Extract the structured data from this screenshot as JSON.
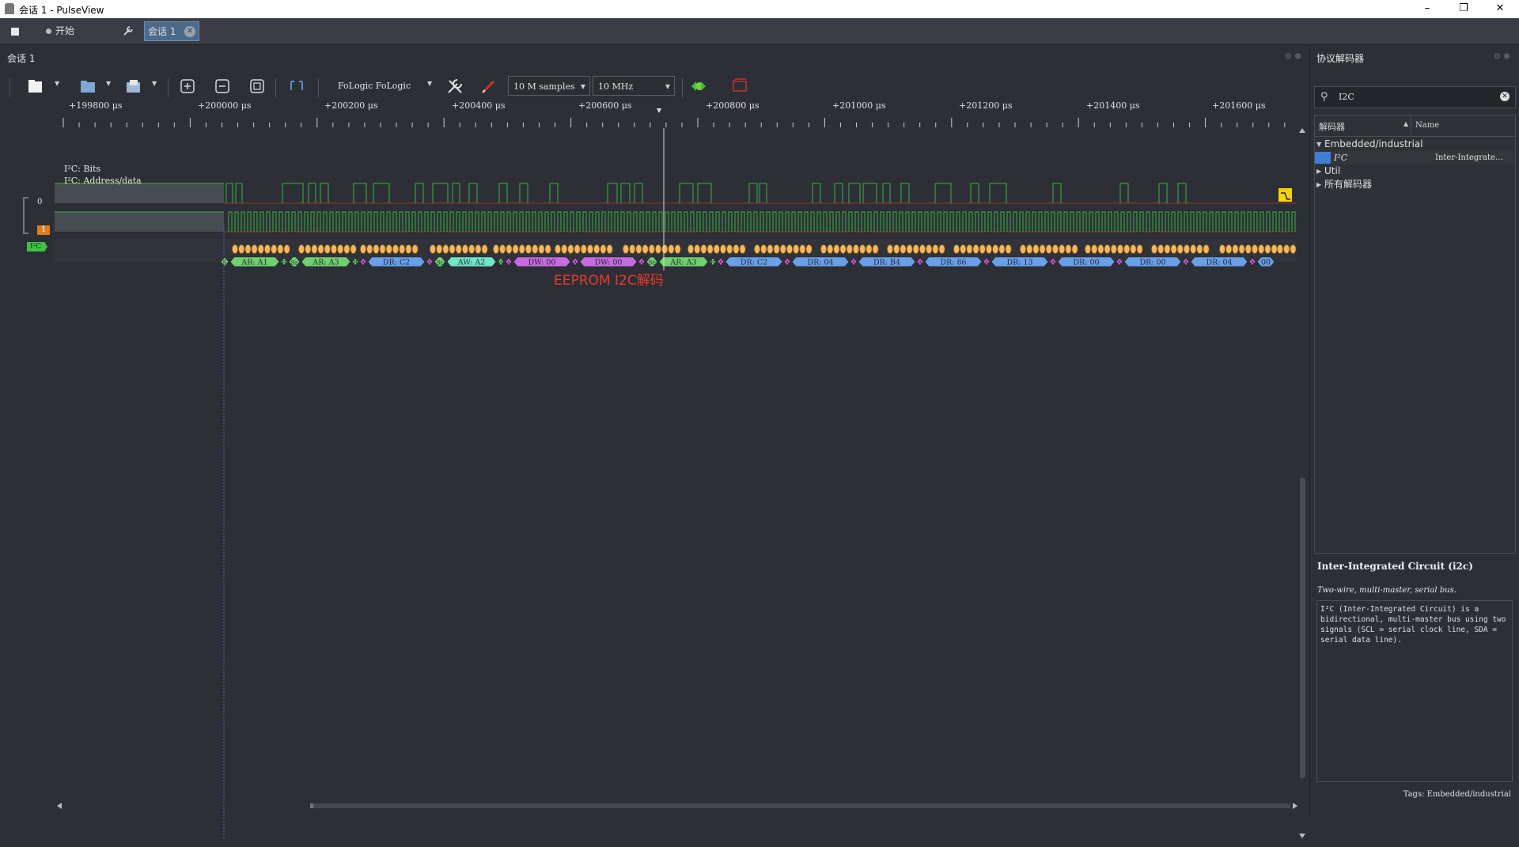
{
  "window": {
    "title": "会话 1 - PulseView",
    "min": "–",
    "max": "❐",
    "close": "✕"
  },
  "tabs": {
    "start_label": "开始",
    "session_label": "会话 1",
    "tools_glyph": "✕"
  },
  "main": {
    "session_label": "会话 1"
  },
  "toolbar": {
    "device": "FoLogic FoLogic",
    "samples": "10 M samples",
    "samplerate": "10 MHz"
  },
  "ruler": {
    "ticks": [
      "+199800 μs",
      "+200000 μs",
      "+200200 μs",
      "+200400 μs",
      "+200600 μs",
      "+200800 μs",
      "+201000 μs",
      "+201200 μs",
      "+201400 μs",
      "+201600 μs"
    ]
  },
  "channels": {
    "ch0": "0",
    "ch1": "1",
    "decoder_badge": "I²C",
    "rows": [
      "I²C: Bits",
      "I²C: Address/data"
    ]
  },
  "bits_label": "0",
  "annotations": [
    {
      "kind": "S",
      "label": "S",
      "color": "#6fd16f"
    },
    {
      "kind": "AR",
      "label": "AR: A1",
      "color": "#6fd16f"
    },
    {
      "kind": "R",
      "label": "R",
      "color": "#6fd16f"
    },
    {
      "kind": "Sr",
      "label": "Sr",
      "color": "#6fd16f"
    },
    {
      "kind": "AR",
      "label": "AR: A3",
      "color": "#6fd16f"
    },
    {
      "kind": "R",
      "label": "R",
      "color": "#6fd16f"
    },
    {
      "kind": "A",
      "label": "A",
      "color": "#e35ee3"
    },
    {
      "kind": "DR",
      "label": "DR: C2",
      "color": "#6aa0e8"
    },
    {
      "kind": "A",
      "label": "A",
      "color": "#e35ee3"
    },
    {
      "kind": "Sr",
      "label": "Sr",
      "color": "#6fd16f"
    },
    {
      "kind": "AW",
      "label": "AW: A2",
      "color": "#6ee8c8"
    },
    {
      "kind": "W",
      "label": "W",
      "color": "#6fd16f"
    },
    {
      "kind": "A",
      "label": "A",
      "color": "#e35ee3"
    },
    {
      "kind": "DW",
      "label": "DW: 00",
      "color": "#c86be0"
    },
    {
      "kind": "A",
      "label": "A",
      "color": "#e35ee3"
    },
    {
      "kind": "DW",
      "label": "DW: 00",
      "color": "#c86be0"
    },
    {
      "kind": "A",
      "label": "A",
      "color": "#e35ee3"
    },
    {
      "kind": "Sr",
      "label": "Sr",
      "color": "#6fd16f"
    },
    {
      "kind": "AR",
      "label": "AR: A3",
      "color": "#6fd16f"
    },
    {
      "kind": "R",
      "label": "R",
      "color": "#6fd16f"
    },
    {
      "kind": "A",
      "label": "A",
      "color": "#e35ee3"
    },
    {
      "kind": "DR",
      "label": "DR: C2",
      "color": "#6aa0e8"
    },
    {
      "kind": "A",
      "label": "A",
      "color": "#e35ee3"
    },
    {
      "kind": "DR",
      "label": "DR: 04",
      "color": "#6aa0e8"
    },
    {
      "kind": "A",
      "label": "A",
      "color": "#e35ee3"
    },
    {
      "kind": "DR",
      "label": "DR: B4",
      "color": "#6aa0e8"
    },
    {
      "kind": "A",
      "label": "A",
      "color": "#e35ee3"
    },
    {
      "kind": "DR",
      "label": "DR: 86",
      "color": "#6aa0e8"
    },
    {
      "kind": "A",
      "label": "A",
      "color": "#e35ee3"
    },
    {
      "kind": "DR",
      "label": "DR: 13",
      "color": "#6aa0e8"
    },
    {
      "kind": "A",
      "label": "A",
      "color": "#e35ee3"
    },
    {
      "kind": "DR",
      "label": "DR: 00",
      "color": "#6aa0e8"
    },
    {
      "kind": "A",
      "label": "A",
      "color": "#e35ee3"
    },
    {
      "kind": "DR",
      "label": "DR: 00",
      "color": "#6aa0e8"
    },
    {
      "kind": "A",
      "label": "A",
      "color": "#e35ee3"
    },
    {
      "kind": "DR",
      "label": "DR: 04",
      "color": "#6aa0e8"
    },
    {
      "kind": "A",
      "label": "A",
      "color": "#e35ee3"
    },
    {
      "kind": "DR",
      "label": "00",
      "color": "#6aa0e8"
    }
  ],
  "overlay_text": "EEPROM I2C解码",
  "decoder_panel": {
    "title": "协议解码器",
    "search_value": "I2C",
    "col_decoder": "解码器",
    "col_name": "Name",
    "tree": [
      {
        "label": "Embedded/industrial",
        "expanded": true
      },
      {
        "label": "I²C",
        "name": "Inter-Integrate…",
        "selected": true
      },
      {
        "label": "Util",
        "expanded": false
      },
      {
        "label": "所有解码器",
        "expanded": false
      }
    ],
    "info_title": "Inter-Integrated Circuit (i2c)",
    "info_subtitle": "Two-wire, multi-master, serial bus.",
    "info_desc": "I²C (Inter-Integrated Circuit) is a bidirectional, multi-master bus using two signals (SCL = serial clock line, SDA = serial data line).",
    "info_tags": "Tags: Embedded/industrial"
  },
  "colors": {
    "bg": "#2c3036",
    "trace_green": "#3cb043",
    "bits_orange": "#f4b85c",
    "cursor_yellow": "#f5d400",
    "annot_red": "#e8392c"
  }
}
